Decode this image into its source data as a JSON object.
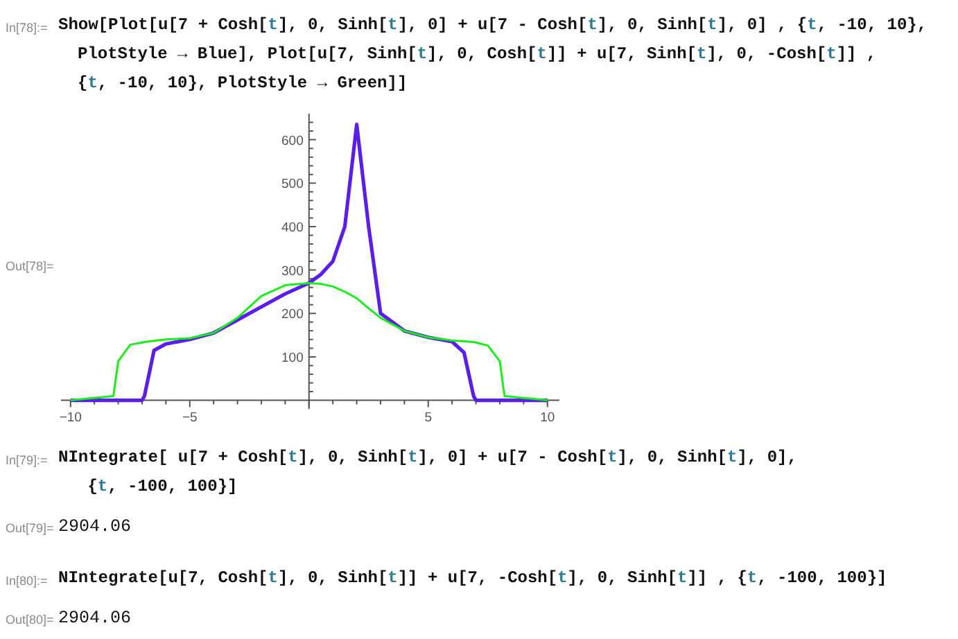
{
  "cells": [
    {
      "kind": "input",
      "label": "In[78]:=",
      "lines": [
        [
          {
            "text": "Show[Plot[u[7 + Cosh[",
            "kind": "code"
          },
          {
            "text": "t",
            "kind": "var"
          },
          {
            "text": "], 0, Sinh[",
            "kind": "code"
          },
          {
            "text": "t",
            "kind": "var"
          },
          {
            "text": "], 0] + u[7 - Cosh[",
            "kind": "code"
          },
          {
            "text": "t",
            "kind": "var"
          },
          {
            "text": "], 0, Sinh[",
            "kind": "code"
          },
          {
            "text": "t",
            "kind": "var"
          },
          {
            "text": "], 0] , {",
            "kind": "code"
          },
          {
            "text": "t",
            "kind": "var"
          },
          {
            "text": ", -10, 10},",
            "kind": "code"
          }
        ],
        [
          {
            "text": "PlotStyle → Blue], Plot[u[7, Sinh[",
            "kind": "code"
          },
          {
            "text": "t",
            "kind": "var"
          },
          {
            "text": "], 0, Cosh[",
            "kind": "code"
          },
          {
            "text": "t",
            "kind": "var"
          },
          {
            "text": "]] + u[7, Sinh[",
            "kind": "code"
          },
          {
            "text": "t",
            "kind": "var"
          },
          {
            "text": "], 0, -Cosh[",
            "kind": "code"
          },
          {
            "text": "t",
            "kind": "var"
          },
          {
            "text": "]] ,",
            "kind": "code"
          }
        ],
        [
          {
            "text": "{",
            "kind": "code"
          },
          {
            "text": "t",
            "kind": "var"
          },
          {
            "text": ", -10, 10}, PlotStyle → Green]]",
            "kind": "code"
          }
        ]
      ]
    },
    {
      "kind": "plot",
      "label": "Out[78]=",
      "chart_data": {
        "type": "line",
        "x": [
          -10,
          -8.2,
          -8,
          -7.5,
          -7,
          -6.9,
          -6.5,
          -6,
          -5,
          -4,
          -3,
          -2,
          -1,
          0,
          0.5,
          1,
          1.5,
          2,
          2.5,
          3,
          4,
          5,
          6,
          6.5,
          6.9,
          7,
          7.5,
          8,
          8.2,
          10
        ],
        "series": [
          {
            "color": "#5a1ee8",
            "values": [
              0,
              0,
              0,
              0,
              0,
              10,
              115,
              130,
              140,
              155,
              185,
              215,
              245,
              270,
              290,
              320,
              400,
              635,
              400,
              200,
              160,
              145,
              135,
              110,
              10,
              0,
              0,
              0,
              0,
              0
            ]
          },
          {
            "color": "#1aee1a",
            "values": [
              0,
              10,
              90,
              128,
              133,
              134,
              137,
              140,
              143,
              155,
              190,
              240,
              265,
              270,
              268,
              262,
              250,
              235,
              212,
              190,
              160,
              145,
              138,
              136,
              134,
              133,
              126,
              90,
              10,
              0
            ]
          }
        ],
        "xlim": [
          -10.4,
          10.5
        ],
        "ylim": [
          -20,
          660
        ],
        "xticks": [
          {
            "value": -10,
            "label": "−10"
          },
          {
            "value": -5,
            "label": "−5"
          },
          5,
          10
        ],
        "yticks": [
          100,
          200,
          300,
          400,
          500,
          600
        ]
      }
    },
    {
      "kind": "input",
      "label": "In[79]:=",
      "lines": [
        [
          {
            "text": "NIntegrate[ u[7 + Cosh[",
            "kind": "code"
          },
          {
            "text": "t",
            "kind": "var"
          },
          {
            "text": "], 0, Sinh[",
            "kind": "code"
          },
          {
            "text": "t",
            "kind": "var"
          },
          {
            "text": "], 0] + u[7 - Cosh[",
            "kind": "code"
          },
          {
            "text": "t",
            "kind": "var"
          },
          {
            "text": "], 0, Sinh[",
            "kind": "code"
          },
          {
            "text": "t",
            "kind": "var"
          },
          {
            "text": "], 0],",
            "kind": "code"
          }
        ],
        [
          {
            "text": " {",
            "kind": "code"
          },
          {
            "text": "t",
            "kind": "var"
          },
          {
            "text": ", -100, 100}]",
            "kind": "code"
          }
        ]
      ]
    },
    {
      "kind": "output",
      "label": "Out[79]=",
      "value": "2904.06"
    },
    {
      "kind": "input",
      "label": "In[80]:=",
      "lines": [
        [
          {
            "text": "NIntegrate[u[7, Cosh[",
            "kind": "code"
          },
          {
            "text": "t",
            "kind": "var"
          },
          {
            "text": "], 0, Sinh[",
            "kind": "code"
          },
          {
            "text": "t",
            "kind": "var"
          },
          {
            "text": "]] + u[7, -Cosh[",
            "kind": "code"
          },
          {
            "text": "t",
            "kind": "var"
          },
          {
            "text": "], 0, Sinh[",
            "kind": "code"
          },
          {
            "text": "t",
            "kind": "var"
          },
          {
            "text": "]] , {",
            "kind": "code"
          },
          {
            "text": "t",
            "kind": "var"
          },
          {
            "text": ", -100, 100}]",
            "kind": "code"
          }
        ]
      ]
    },
    {
      "kind": "output",
      "label": "Out[80]=",
      "value": "2904.06"
    }
  ]
}
